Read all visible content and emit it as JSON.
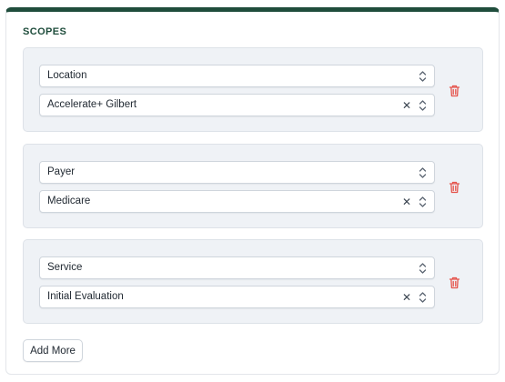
{
  "section": {
    "title": "SCOPES"
  },
  "scopes": [
    {
      "type": "Location",
      "value": "Accelerate+ Gilbert"
    },
    {
      "type": "Payer",
      "value": "Medicare"
    },
    {
      "type": "Service",
      "value": "Initial Evaluation"
    }
  ],
  "actions": {
    "add_more_label": "Add More"
  },
  "icons": {
    "chevron": "chevron-up-down-icon",
    "clear": "close-icon",
    "delete": "trash-icon"
  },
  "colors": {
    "accent": "#1f4d3c",
    "card_bg": "#eff2f6",
    "delete": "#e5534b"
  }
}
